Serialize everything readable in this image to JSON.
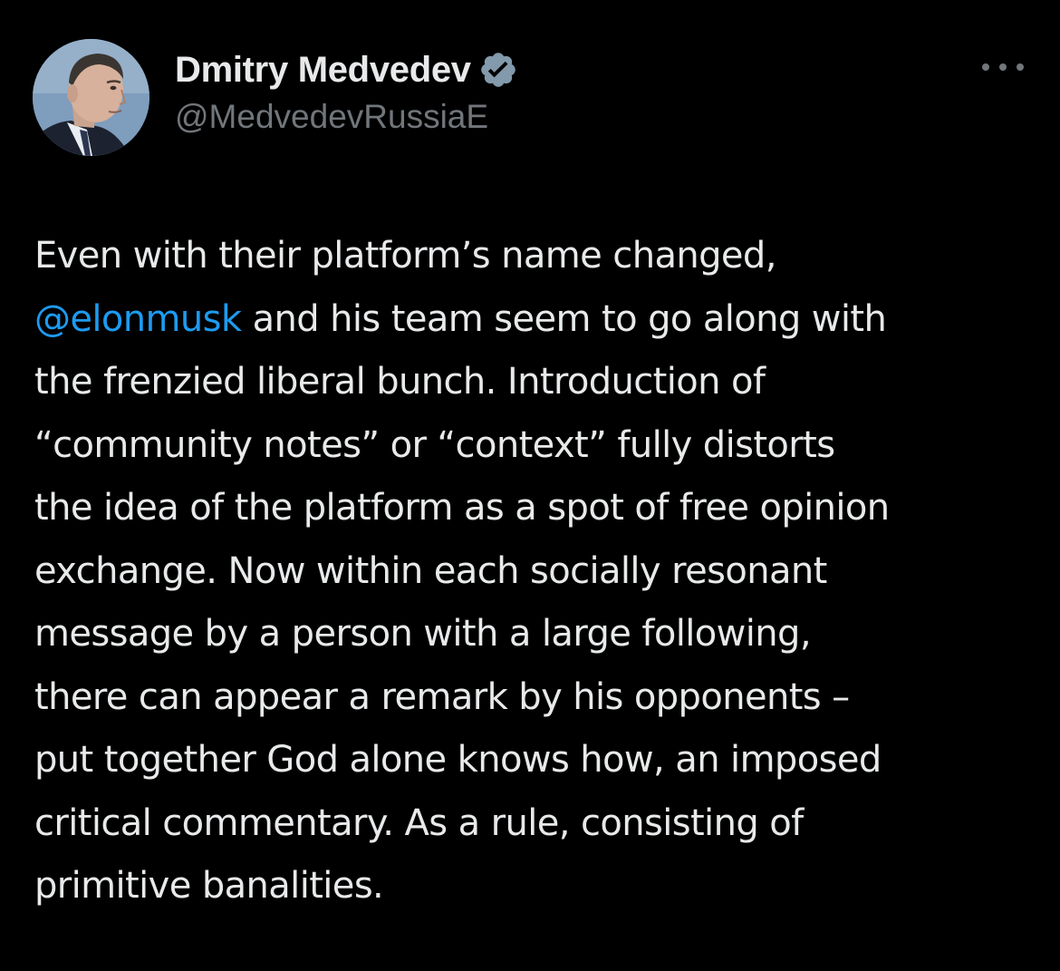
{
  "author": {
    "name": "Dmitry Medvedev",
    "handle": "@MedvedevRussiaE",
    "verified_badge_color": "#829aab",
    "avatar_icon": "portrait-avatar"
  },
  "menu": {
    "icon": "more-horizontal-icon"
  },
  "post": {
    "lines": [
      {
        "text": "Even with their platform’s name changed,"
      },
      {
        "mention": "@elonmusk",
        "text": " and his team seem to go along with"
      },
      {
        "text": "the frenzied liberal bunch. Introduction of"
      },
      {
        "text": "“community notes” or “context” fully distorts"
      },
      {
        "text": "the idea of the platform as a spot of free opinion"
      },
      {
        "text": "exchange. Now within each socially resonant"
      },
      {
        "text": "message by a person with a large following,"
      },
      {
        "text": "there can appear a remark by his opponents –"
      },
      {
        "text": "put together God alone knows how, an imposed"
      },
      {
        "text": "critical commentary. As a rule, consisting of"
      },
      {
        "text": "primitive banalities."
      }
    ]
  },
  "colors": {
    "background": "#000000",
    "text": "#e7e9ea",
    "secondary": "#71767b",
    "link": "#1d9bf0"
  }
}
